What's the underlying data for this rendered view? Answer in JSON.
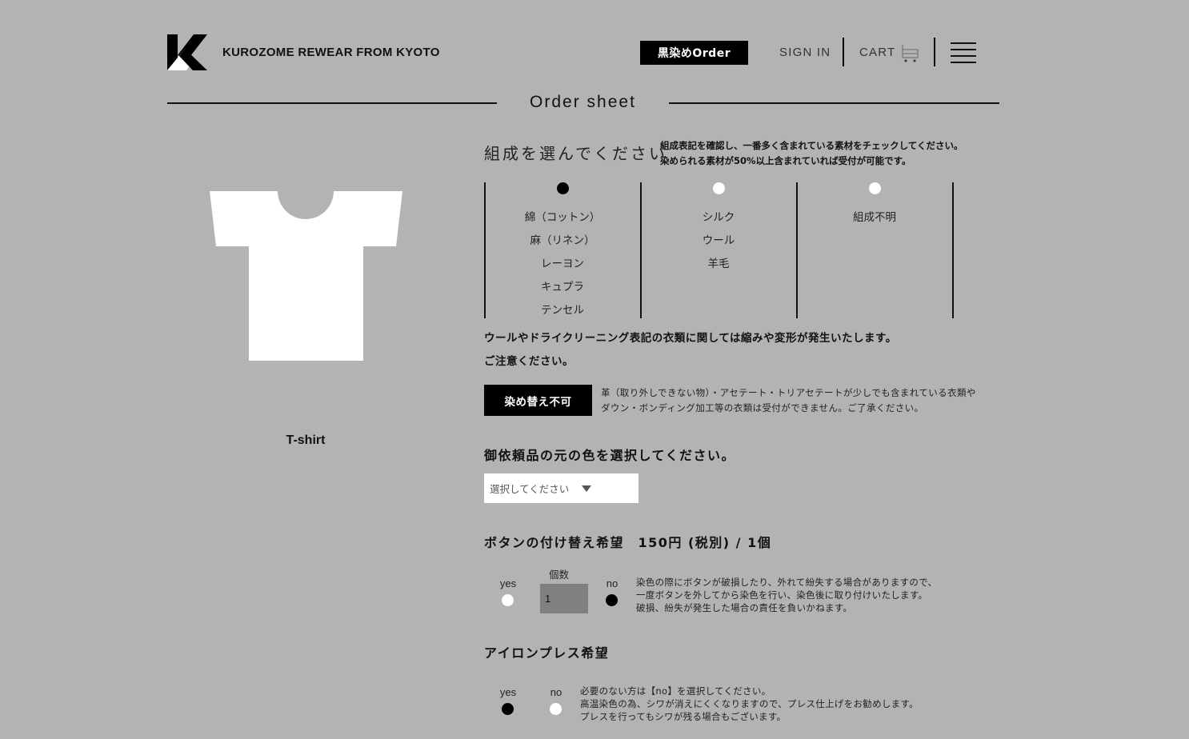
{
  "header": {
    "brand": "KUROZOME REWEAR FROM KYOTO",
    "order_button": "黒染めOrder",
    "sign_in": "SIGN IN",
    "cart": "CART"
  },
  "page_title": "Order sheet",
  "product": {
    "name": "T-shirt"
  },
  "composition": {
    "title": "組成を選んでください",
    "note_lines": [
      "組成表記を確認し、一番多く含まれている素材をチェックしてください。",
      "染められる素材が50%以上含まれていれば受付が可能です。"
    ],
    "options": [
      {
        "selected": true,
        "items": [
          "綿（コットン）",
          "麻（リネン）",
          "レーヨン",
          "キュプラ",
          "テンセル"
        ]
      },
      {
        "selected": false,
        "items": [
          "シルク",
          "ウール",
          "羊毛"
        ]
      },
      {
        "selected": false,
        "items": [
          "組成不明"
        ]
      }
    ],
    "warning_lines": [
      "ウールやドライクリーニング表記の衣類に関しては縮みや変形が発生いたします。",
      "ご注意ください。"
    ]
  },
  "not_accepted": {
    "badge": "染め替え不可",
    "lines": [
      "革（取り外しできない物）・アセテート・トリアセテートが少しでも含まれている衣類や",
      "ダウン・ボンディング加工等の衣類は受付ができません。ご了承ください。"
    ]
  },
  "original_color": {
    "title": "御依頼品の元の色を選択してください。",
    "select_value": "選択してください"
  },
  "button_replace": {
    "title": "ボタンの付け替え希望　150円 (税別) / 1個",
    "yes_label": "yes",
    "no_label": "no",
    "yes_selected": false,
    "no_selected": true,
    "qty_label": "個数",
    "qty_value": "1",
    "note_lines": [
      "染色の際にボタンが破損したり、外れて紛失する場合がありますので、",
      "一度ボタンを外してから染色を行い、染色後に取り付けいたします。",
      "破損、紛失が発生した場合の責任を負いかねます。"
    ]
  },
  "iron_press": {
    "title": "アイロンプレス希望",
    "yes_label": "yes",
    "no_label": "no",
    "yes_selected": true,
    "no_selected": false,
    "note_lines": [
      "必要のない方は【no】を選択してください。",
      "高温染色の為、シワが消えにくくなりますので、プレス仕上げをお勧めします。",
      "プレスを行ってもシワが残る場合もございます。"
    ]
  }
}
